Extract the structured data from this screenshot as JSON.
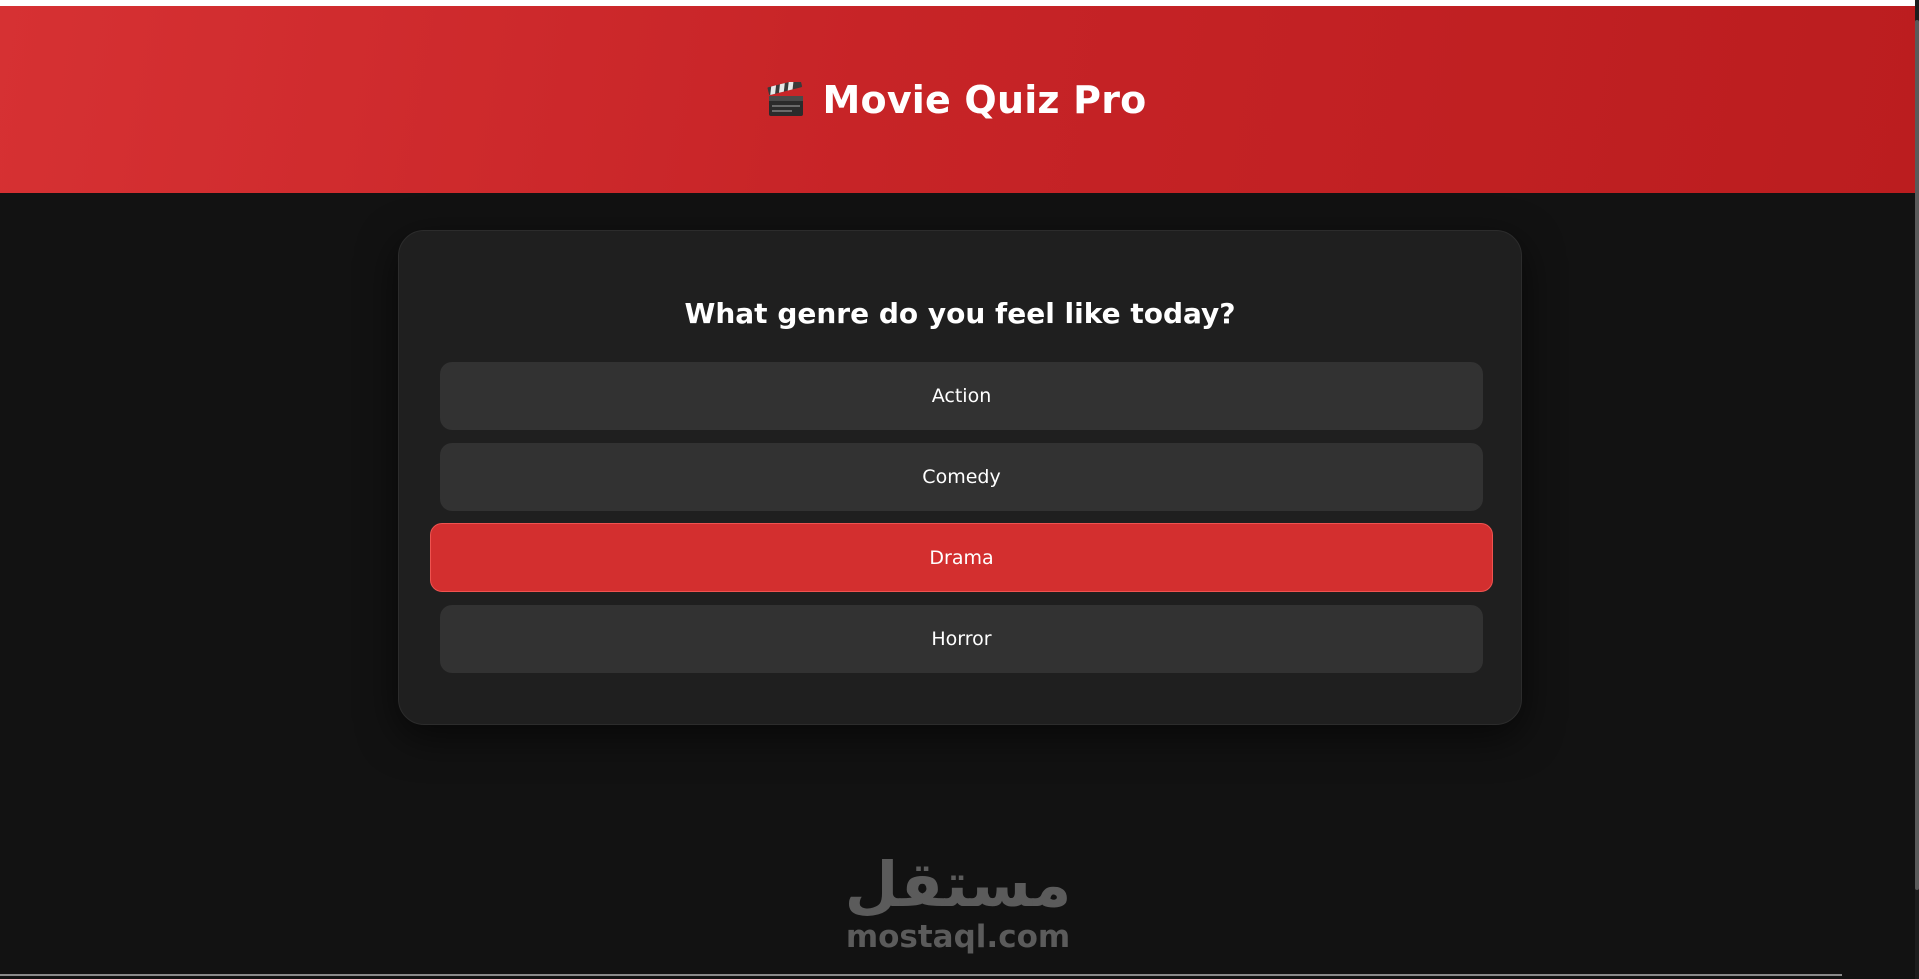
{
  "header": {
    "title": "Movie Quiz Pro",
    "icon": "clapperboard-icon"
  },
  "quiz": {
    "question": "What genre do you feel like today?",
    "options": [
      {
        "label": "Action",
        "selected": false
      },
      {
        "label": "Comedy",
        "selected": false
      },
      {
        "label": "Drama",
        "selected": true
      },
      {
        "label": "Horror",
        "selected": false
      }
    ]
  },
  "watermark": {
    "arabic": "مستقل",
    "latin": "mostaql.com"
  },
  "colors": {
    "accent": "#d32f2f",
    "background": "#121212",
    "card": "#1f1f1f",
    "option": "#323232"
  }
}
